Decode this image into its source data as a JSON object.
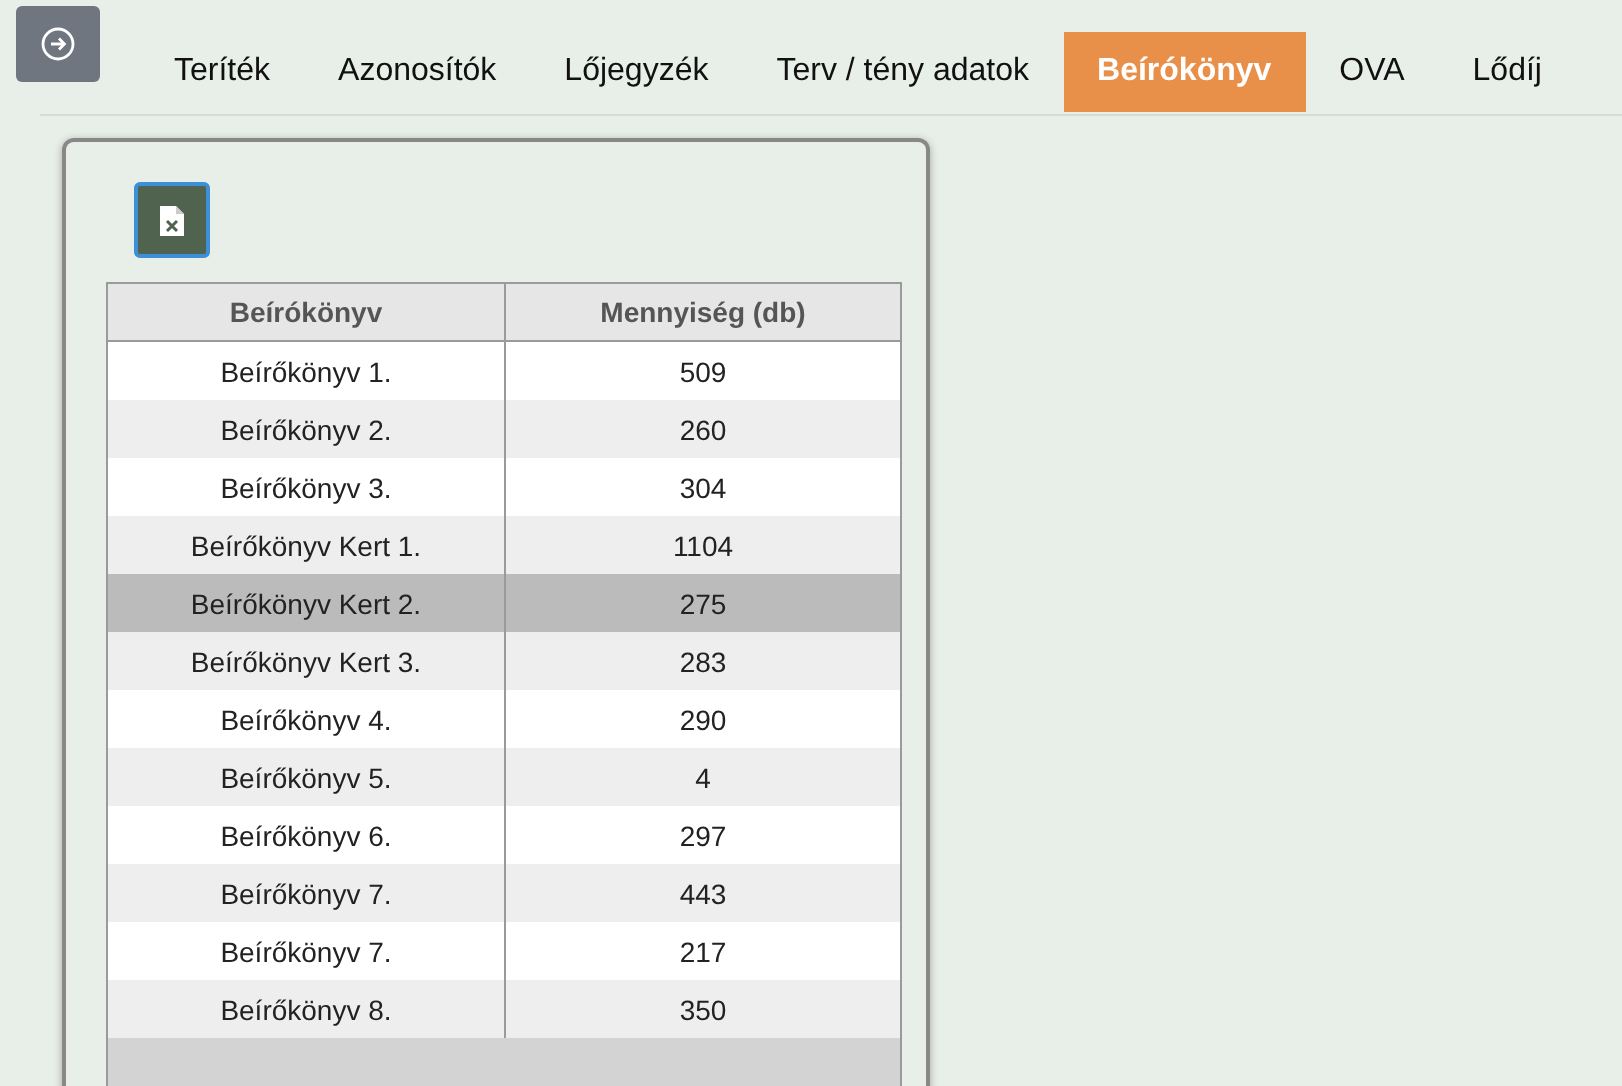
{
  "tabs": [
    {
      "label": "Teríték",
      "selected": false
    },
    {
      "label": "Azonosítók",
      "selected": false
    },
    {
      "label": "Lőjegyzék",
      "selected": false
    },
    {
      "label": "Terv / tény adatok",
      "selected": false
    },
    {
      "label": "Beírókönyv",
      "selected": true
    },
    {
      "label": "OVA",
      "selected": false
    },
    {
      "label": "Lődíj",
      "selected": false
    }
  ],
  "table": {
    "columns": [
      "Beírókönyv",
      "Mennyiség (db)"
    ],
    "rows": [
      {
        "cells": [
          "Beírőkönyv 1.",
          "509"
        ],
        "selected": false
      },
      {
        "cells": [
          "Beírőkönyv 2.",
          "260"
        ],
        "selected": false
      },
      {
        "cells": [
          "Beírőkönyv 3.",
          "304"
        ],
        "selected": false
      },
      {
        "cells": [
          "Beírőkönyv Kert 1.",
          "1104"
        ],
        "selected": false
      },
      {
        "cells": [
          "Beírőkönyv Kert 2.",
          "275"
        ],
        "selected": true
      },
      {
        "cells": [
          "Beírőkönyv Kert 3.",
          "283"
        ],
        "selected": false
      },
      {
        "cells": [
          "Beírőkönyv 4.",
          "290"
        ],
        "selected": false
      },
      {
        "cells": [
          "Beírőkönyv 5.",
          "4"
        ],
        "selected": false
      },
      {
        "cells": [
          "Beírőkönyv 6.",
          "297"
        ],
        "selected": false
      },
      {
        "cells": [
          "Beírőkönyv 7.",
          "443"
        ],
        "selected": false
      },
      {
        "cells": [
          "Beírőkönyv 7.",
          "217"
        ],
        "selected": false
      },
      {
        "cells": [
          "Beírőkönyv 8.",
          "350"
        ],
        "selected": false
      }
    ]
  }
}
